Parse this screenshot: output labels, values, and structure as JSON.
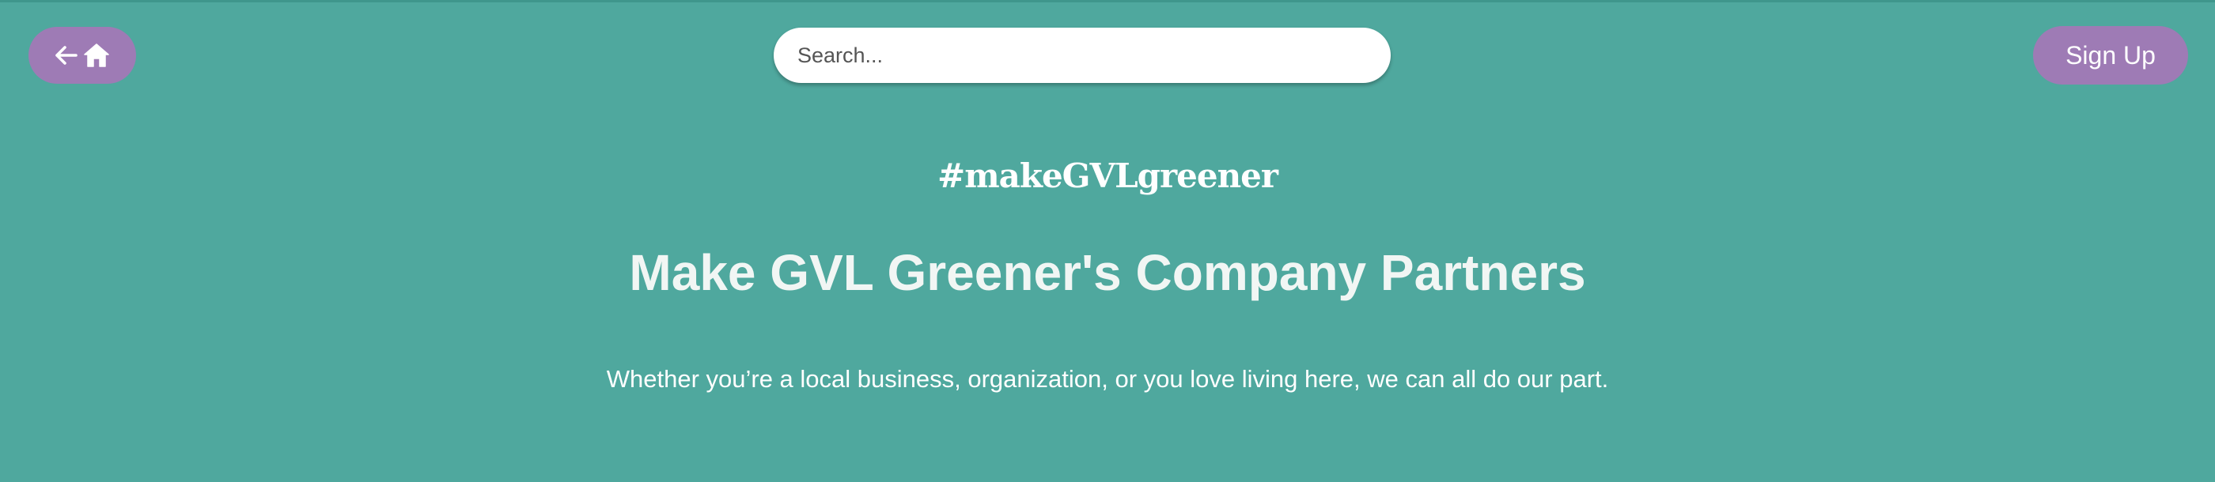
{
  "header": {
    "home_button": {
      "icons": [
        "arrow-left-icon",
        "home-icon"
      ]
    },
    "search": {
      "placeholder": "Search...",
      "value": ""
    },
    "signup_label": "Sign Up"
  },
  "main": {
    "tagline": "#makeGVLgreener",
    "title": "Make GVL Greener's Company Partners",
    "intro": "Whether you’re a local business, organization, or you love living here, we can all do our part."
  },
  "colors": {
    "background": "#4fa89e",
    "button_accent": "#9e7bb5",
    "text": "#ffffff"
  }
}
